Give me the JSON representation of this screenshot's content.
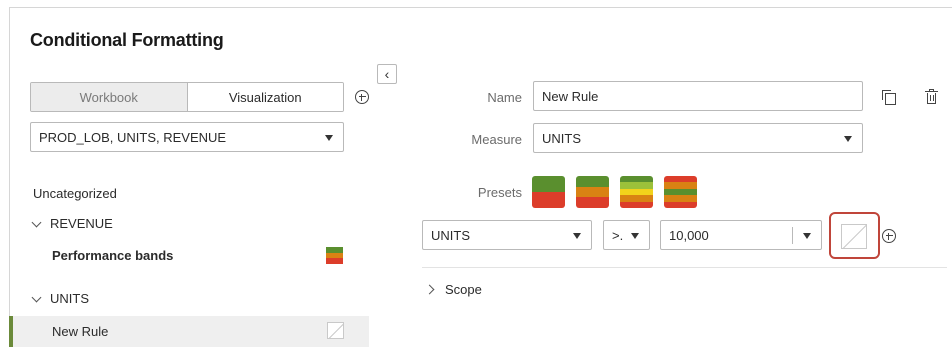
{
  "dialog": {
    "title": "Conditional Formatting"
  },
  "tabs": [
    {
      "label": "Workbook",
      "active": false
    },
    {
      "label": "Visualization",
      "active": true
    }
  ],
  "columns_select": {
    "value": "PROD_LOB, UNITS, REVENUE"
  },
  "tree": {
    "section_label": "Uncategorized",
    "groups": [
      {
        "label": "REVENUE",
        "rules": [
          {
            "label": "Performance bands",
            "icon": "performance-bands-icon"
          }
        ]
      },
      {
        "label": "UNITS",
        "rules": [
          {
            "label": "New Rule",
            "icon": "empty-color-swatch",
            "selected": true
          }
        ]
      }
    ]
  },
  "form": {
    "name_label": "Name",
    "name_value": "New Rule",
    "measure_label": "Measure",
    "measure_value": "UNITS",
    "presets_label": "Presets",
    "condition": {
      "field": "UNITS",
      "operator": ">.",
      "value": "10,000"
    },
    "scope_label": "Scope"
  },
  "colors": {
    "green": "#5a8f2e",
    "orange": "#d98213",
    "red": "#dc3d2a",
    "yellow": "#f2d21b",
    "lightgreen": "#9cc13a",
    "highlight": "#c0453a",
    "selected_accent": "#6b8a3a"
  }
}
